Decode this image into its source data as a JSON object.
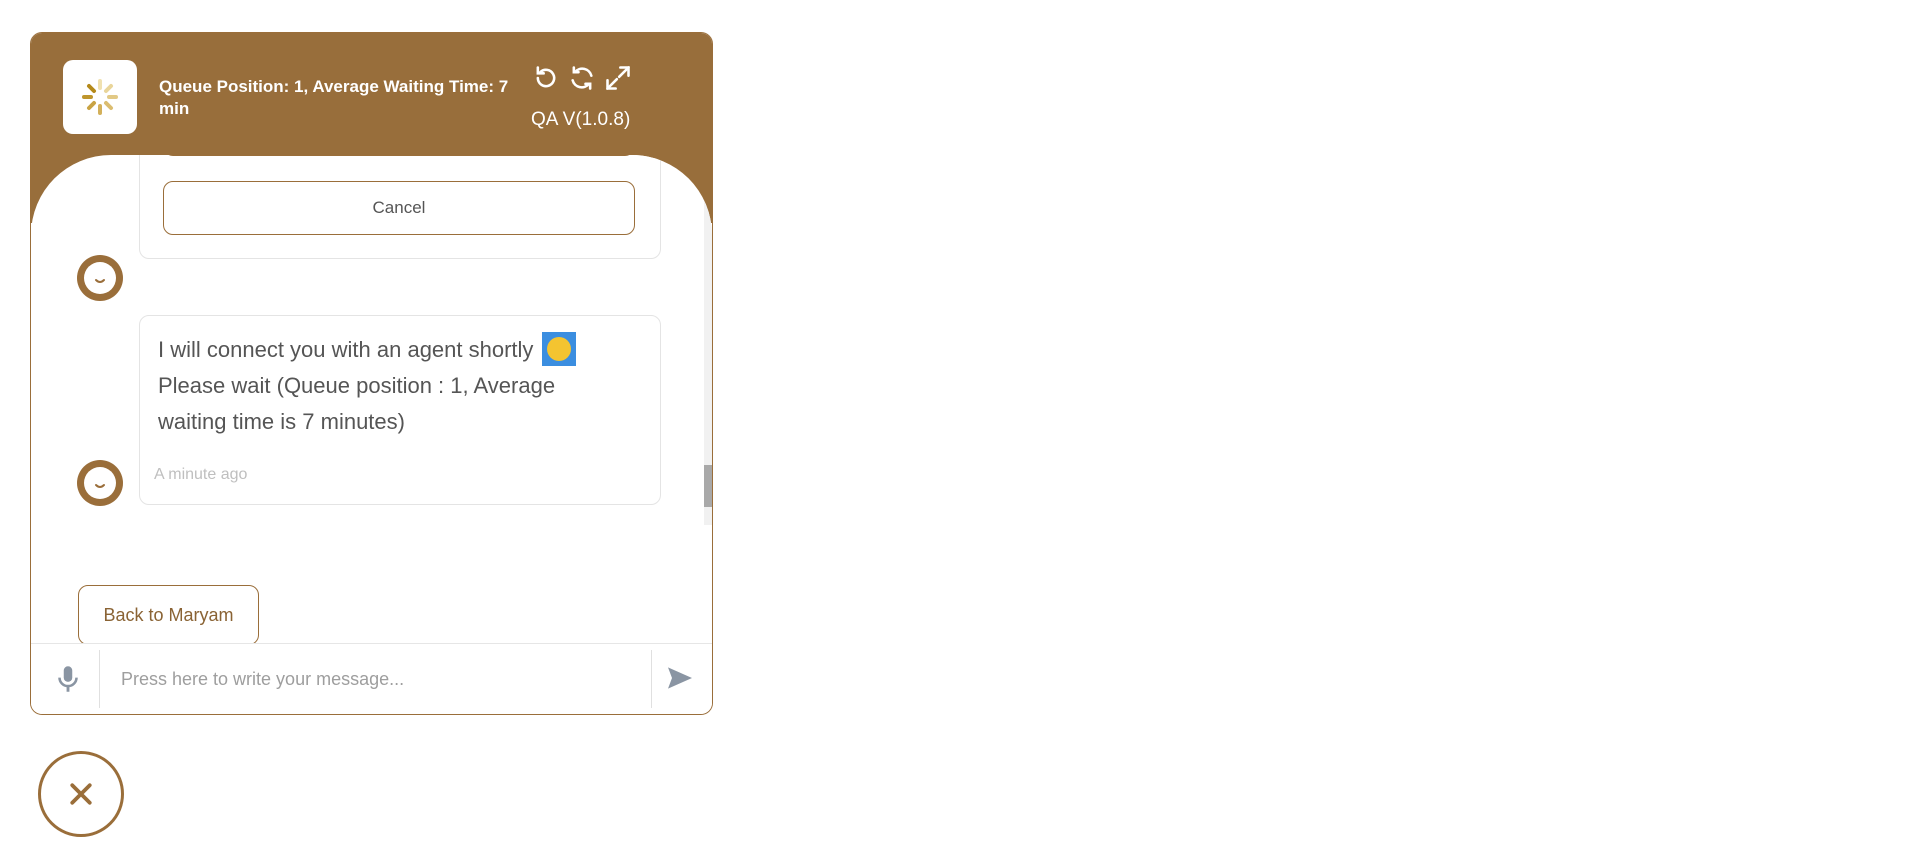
{
  "header": {
    "title": "Queue Position: 1, Average Waiting Time: 7 min",
    "version": "QA V(1.0.8)",
    "icons": [
      "undo-icon",
      "refresh-icon",
      "expand-icon"
    ]
  },
  "messages": {
    "options": {
      "cancel_label": "Cancel"
    },
    "bot_message": {
      "line1": "I will connect you with an agent shortly",
      "line2": "Please wait (Queue position : 1, Average waiting time is 7 minutes)",
      "timestamp": "A minute ago"
    }
  },
  "actions": {
    "back_label": "Back to Maryam"
  },
  "composer": {
    "placeholder": "Press here to write your message..."
  },
  "colors": {
    "brand": "#986e3b",
    "emoji_highlight": "#3b8ee0"
  }
}
